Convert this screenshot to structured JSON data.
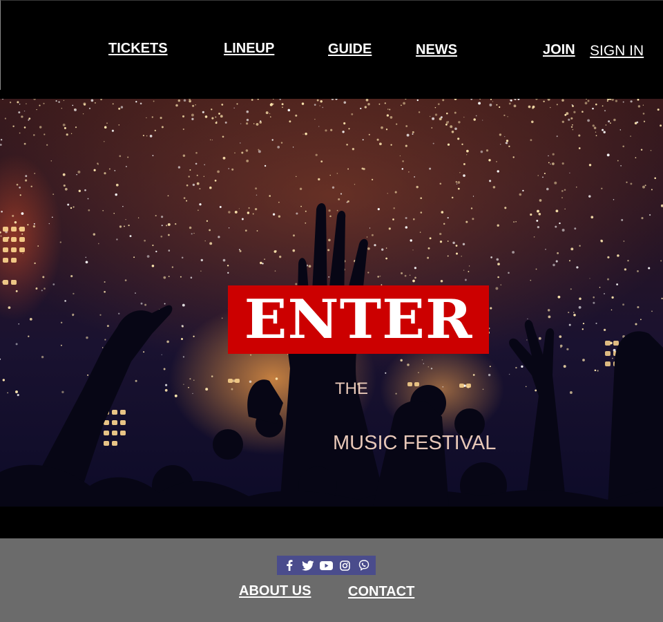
{
  "nav": {
    "tickets": "TICKETS",
    "lineup": "LINEUP",
    "guide": "GUIDE",
    "news": "NEWS",
    "join": "JOIN",
    "sign_in": "SIGN IN"
  },
  "hero": {
    "title": "ENTER",
    "subtitle_line1": "THE",
    "subtitle_line2": "MUSIC FESTIVAL",
    "title_box_color": "#cc0000",
    "subtitle_color": "#e8c8b8",
    "image_description_icon": "concert-crowd-image"
  },
  "footer": {
    "social": {
      "background_color": "#4a4c8c",
      "icons": [
        "facebook-icon",
        "twitter-icon",
        "youtube-icon",
        "instagram-icon",
        "viber-icon"
      ]
    },
    "about_us": "ABOUT US",
    "contact": "CONTACT"
  },
  "colors": {
    "header_bg": "#000000",
    "footer_bg": "#6b6b6b",
    "link_color": "#ffffff"
  }
}
